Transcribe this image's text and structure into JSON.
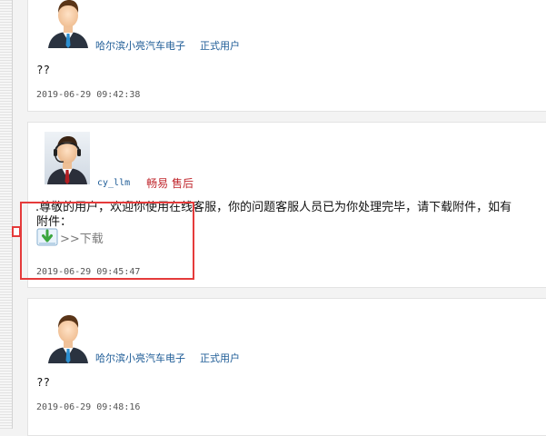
{
  "posts": [
    {
      "user_name": "哈尔滨小亮汽车电子",
      "user_role": "正式用户",
      "message": "??",
      "timestamp": "2019-06-29 09:42:38",
      "avatar_icon": "male-user-avatar-icon"
    },
    {
      "user_name": "cy_llm",
      "user_role": "畅易 售后",
      "message": ".尊敬的用户，欢迎你使用在线客服，你的问题客服人员已为你处理完毕，请下载附件，如有",
      "attachment_label": "附件：",
      "download_label": ">>下载",
      "timestamp": "2019-06-29 09:45:47",
      "avatar_icon": "support-agent-headset-avatar-icon",
      "download_icon": "download-arrow-icon"
    },
    {
      "user_name": "哈尔滨小亮汽车电子",
      "user_role": "正式用户",
      "message": "??",
      "timestamp": "2019-06-29 09:48:16",
      "avatar_icon": "male-user-avatar-icon"
    }
  ],
  "colors": {
    "user_link": "#1d5b96",
    "agent_role": "#c0272d",
    "highlight": "#e53b3b"
  }
}
